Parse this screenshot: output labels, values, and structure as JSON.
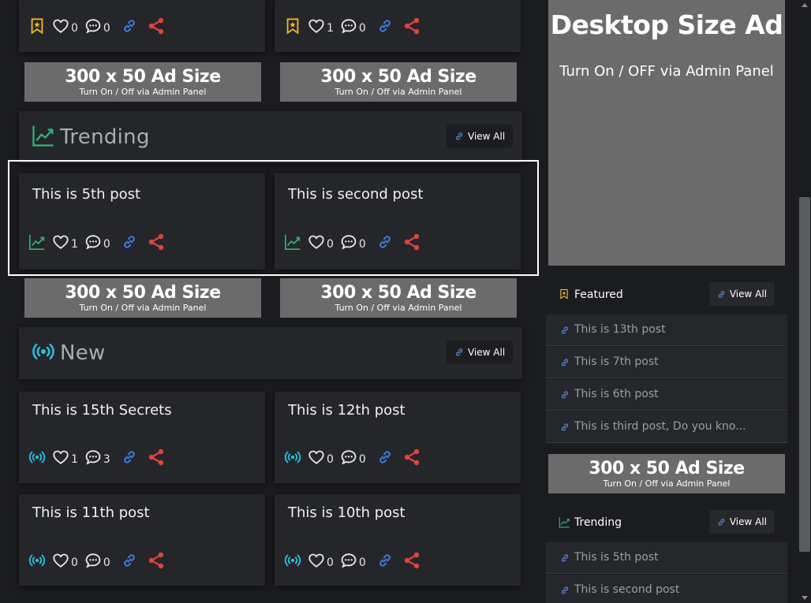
{
  "colors": {
    "trending": "#2fb67a",
    "new": "#22c2e6",
    "link": "#3b7de0",
    "share": "#e0433a",
    "bookmark": "#f1b52c"
  },
  "top_cards": [
    {
      "likes": "0",
      "comments": "0"
    },
    {
      "likes": "1",
      "comments": "0"
    }
  ],
  "ad": {
    "big": "300 x 50 Ad Size",
    "small": "Turn On / Off via Admin Panel"
  },
  "trending": {
    "title": "Trending",
    "view_all": "View All",
    "posts": [
      {
        "title": "This is 5th post",
        "likes": "1",
        "comments": "0"
      },
      {
        "title": "This is second post",
        "likes": "0",
        "comments": "0"
      }
    ]
  },
  "new_section": {
    "title": "New",
    "view_all": "View All",
    "posts": [
      {
        "title": "This is 15th Secrets",
        "likes": "1",
        "comments": "3"
      },
      {
        "title": "This is 12th post",
        "likes": "0",
        "comments": "0"
      },
      {
        "title": "This is 11th post",
        "likes": "0",
        "comments": "0"
      },
      {
        "title": "This is 10th post",
        "likes": "0",
        "comments": "0"
      }
    ]
  },
  "sidebar": {
    "desktop_ad": {
      "big": "Desktop Size Ad",
      "small": "Turn On / OFF via Admin Panel"
    },
    "featured": {
      "title": "Featured",
      "view_all": "View All",
      "items": [
        "This is 13th post",
        "This is 7th post",
        "This is 6th post",
        "This is third post, Do you kno..."
      ]
    },
    "ad": {
      "big": "300 x 50 Ad Size",
      "small": "Turn On / Off via Admin Panel"
    },
    "trending": {
      "title": "Trending",
      "view_all": "View All",
      "items": [
        "This is 5th post",
        "This is second post"
      ]
    }
  }
}
